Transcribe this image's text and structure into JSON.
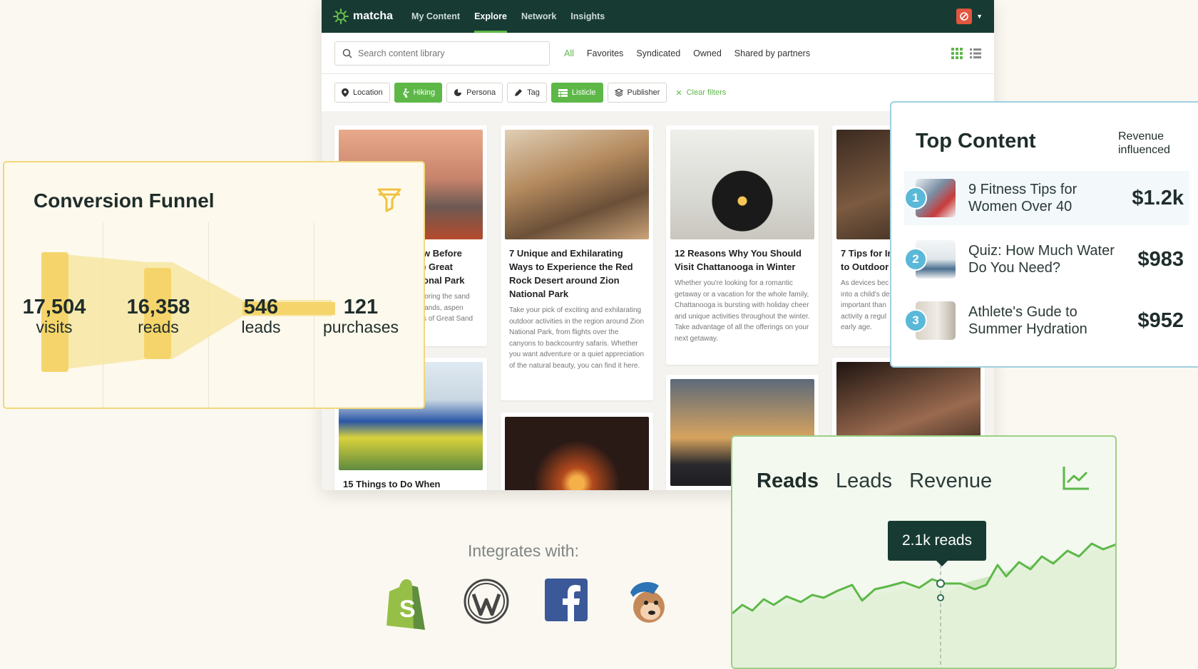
{
  "app": {
    "logo": "matcha",
    "nav": [
      {
        "label": "My Content"
      },
      {
        "label": "Explore"
      },
      {
        "label": "Network"
      },
      {
        "label": "Insights"
      }
    ],
    "search_placeholder": "Search content library",
    "tabs": [
      "All",
      "Favorites",
      "Syndicated",
      "Owned",
      "Shared by partners"
    ],
    "filters": [
      {
        "label": "Location",
        "icon": "pin-icon"
      },
      {
        "label": "Hiking",
        "icon": "hiker-icon"
      },
      {
        "label": "Persona",
        "icon": "pie-icon"
      },
      {
        "label": "Tag",
        "icon": "tag-icon"
      },
      {
        "label": "Listicle",
        "icon": "list-icon"
      },
      {
        "label": "Publisher",
        "icon": "stack-icon"
      }
    ],
    "clear_filters": "Clear filters"
  },
  "cards": [
    {
      "title": "w Before\n) Great\nonal Park",
      "body": "loring the sand\nlands, aspen\ns of Great Sand"
    },
    {
      "title": "7 Unique and Exhilarating Ways to Experience the Red Rock Desert around Zion National Park",
      "body": "Take your pick of exciting and exhilarating outdoor activities in the region around Zion National Park, from flights over the canyons to backcountry safaris. Whether you want adventure or a quiet appreciation of the natural beauty, you can find it here."
    },
    {
      "title": "12 Reasons Why You Should Visit Chattanooga in Winter",
      "body": "Whether you're looking for a romantic getaway or a vacation for the whole family, Chattanooga is bursting with holiday cheer and unique activities throughout the winter. Take advantage of all the offerings on your next getaway."
    },
    {
      "title": "7 Tips for Ir\nto Outdoor A",
      "body": "As devices bec\ninto a child's de\nimportant than\nactivity a regul\nearly age."
    },
    {
      "title": "15 Things to Do When"
    }
  ],
  "funnel": {
    "title": "Conversion Funnel",
    "stages": [
      {
        "value": "17,504",
        "label": "visits"
      },
      {
        "value": "16,358",
        "label": "reads"
      },
      {
        "value": "546",
        "label": "leads"
      },
      {
        "value": "121",
        "label": "purchases"
      }
    ]
  },
  "top_content": {
    "title": "Top Content",
    "revenue_header": "Revenue influenced",
    "items": [
      {
        "rank": "1",
        "title": "9 Fitness Tips for Women Over 40",
        "value": "$1.2k"
      },
      {
        "rank": "2",
        "title": "Quiz: How Much Water Do You Need?",
        "value": "$983"
      },
      {
        "rank": "3",
        "title": "Athlete's Gude to Summer Hydration",
        "value": "$952"
      }
    ]
  },
  "reads_chart": {
    "tabs": [
      "Reads",
      "Leads",
      "Revenue"
    ],
    "tooltip": "2.1k reads"
  },
  "integrations": {
    "title": "Integrates with:",
    "logos": [
      "shopify-logo",
      "wordpress-logo",
      "facebook-logo",
      "mailchimp-logo"
    ]
  },
  "colors": {
    "brand_dark": "#173b33",
    "brand_green": "#5db848",
    "funnel_yellow": "#f5d56b",
    "accent_blue": "#5ab8d8"
  }
}
